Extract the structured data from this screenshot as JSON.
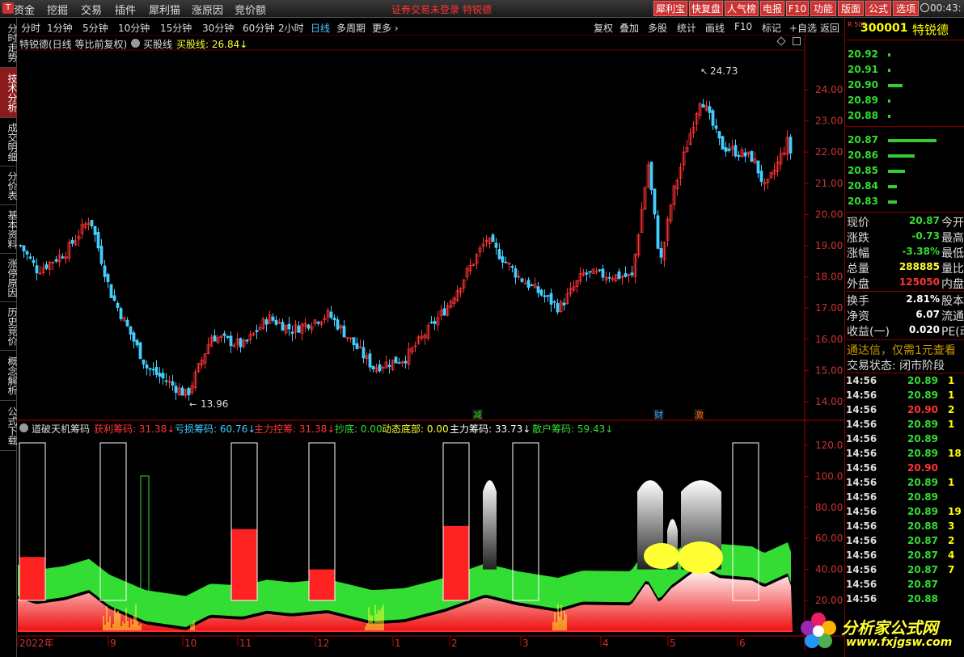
{
  "menu": {
    "items": [
      "资金",
      "挖掘",
      "交易",
      "插件",
      "犀利猫",
      "涨原因",
      "竞价额"
    ],
    "notice": "证券交易未登录  特锐德",
    "right_buttons": [
      "犀利宝",
      "快复盘",
      "人气榜",
      "电报",
      "F10",
      "功能",
      "版面",
      "公式",
      "选项"
    ],
    "clock": "00:43:"
  },
  "left_tabs": [
    "分时走势",
    "技术分析",
    "成交明细",
    "分价表",
    "基本资料",
    "涨停原因",
    "历史竞价",
    "概念解析",
    "公式下载"
  ],
  "periods": [
    "分时",
    "1分钟",
    "5分钟",
    "10分钟",
    "15分钟",
    "30分钟",
    "60分钟",
    "2小时",
    "日线",
    "多周期",
    "更多 ›"
  ],
  "toolbar_right": [
    "复权",
    "叠加",
    "多股",
    "统计",
    "画线",
    "F10",
    "标记",
    "+自选",
    "返回"
  ],
  "main_header": {
    "title": "特锐德(日线 等比前复权)",
    "indicator": "买股线",
    "buy_line": "买股线: 26.84↓"
  },
  "sub_header": {
    "name": "道破天机筹码",
    "items": [
      {
        "text": "获利筹码: 31.38↓",
        "color": "#ff3333"
      },
      {
        "text": "亏损筹码: 60.76↓",
        "color": "#44ccff"
      },
      {
        "text": "主力控筹: 31.38↓",
        "color": "#ff3333"
      },
      {
        "text": "抄底: 0.00",
        "color": "#33dd33"
      },
      {
        "text": "动态底部: 0.00",
        "color": "#ffff33"
      },
      {
        "text": "主力筹码: 33.73↓",
        "color": "#ffffff"
      },
      {
        "text": "散户筹码: 59.43↓",
        "color": "#33dd33"
      }
    ]
  },
  "main_axis": [
    "24.00",
    "23.00",
    "22.00",
    "21.00",
    "20.00",
    "19.00",
    "18.00",
    "17.00",
    "16.00",
    "15.00",
    "14.00"
  ],
  "sub_axis": [
    "120.0",
    "100.0",
    "80.00",
    "60.00",
    "40.00",
    "20.00"
  ],
  "high_label": "24.73",
  "low_label": "13.96",
  "markers": [
    {
      "text": "减",
      "color": "#33dd33"
    },
    {
      "text": "财",
      "color": "#44aaff"
    },
    {
      "text": "激",
      "color": "#ff6600"
    }
  ],
  "time_axis": [
    "2022年",
    "9",
    "10",
    "11",
    "12",
    "1",
    "2",
    "3",
    "4",
    "5",
    "6"
  ],
  "quote": {
    "code": "300001",
    "name": "特锐德",
    "r_label": "R 500",
    "asks": [
      {
        "price": "20.92",
        "vol": 0.05
      },
      {
        "price": "20.91",
        "vol": 0.05
      },
      {
        "price": "20.90",
        "vol": 0.3
      },
      {
        "price": "20.89",
        "vol": 0.05
      },
      {
        "price": "20.88",
        "vol": 0.05
      }
    ],
    "bids": [
      {
        "price": "20.87",
        "vol": 1.0
      },
      {
        "price": "20.86",
        "vol": 0.55
      },
      {
        "price": "20.85",
        "vol": 0.35
      },
      {
        "price": "20.84",
        "vol": 0.18
      },
      {
        "price": "20.83",
        "vol": 0.18
      }
    ],
    "stats": [
      {
        "label": "现价",
        "value": "20.87",
        "color": "#33dd33",
        "right": "今开"
      },
      {
        "label": "涨跌",
        "value": "-0.73",
        "color": "#33dd33",
        "right": "最高"
      },
      {
        "label": "涨幅",
        "value": "-3.38%",
        "color": "#33dd33",
        "right": "最低"
      },
      {
        "label": "总量",
        "value": "288885",
        "color": "#ffff33",
        "right": "量比"
      },
      {
        "label": "外盘",
        "value": "125050",
        "color": "#ff3333",
        "right": "内盘"
      },
      {
        "label": "换手",
        "value": "2.81%",
        "color": "#ffffff",
        "right": "股本"
      },
      {
        "label": "净资",
        "value": "6.07",
        "color": "#ffffff",
        "right": "流通"
      },
      {
        "label": "收益(一)",
        "value": "0.020",
        "color": "#ffffff",
        "right": "PE(动"
      }
    ],
    "ad": "通达信，仅需1元查看",
    "trade_status": "交易状态: 闭市阶段",
    "ticks": [
      {
        "t": "14:56",
        "p": "20.89",
        "v": "1"
      },
      {
        "t": "14:56",
        "p": "20.89",
        "v": "1"
      },
      {
        "t": "14:56",
        "p": "20.90",
        "v": "2"
      },
      {
        "t": "14:56",
        "p": "20.89",
        "v": "1"
      },
      {
        "t": "14:56",
        "p": "20.89",
        "v": ""
      },
      {
        "t": "14:56",
        "p": "20.89",
        "v": "18"
      },
      {
        "t": "14:56",
        "p": "20.90",
        "v": ""
      },
      {
        "t": "14:56",
        "p": "20.89",
        "v": "1"
      },
      {
        "t": "14:56",
        "p": "20.89",
        "v": ""
      },
      {
        "t": "14:56",
        "p": "20.89",
        "v": "19"
      },
      {
        "t": "14:56",
        "p": "20.88",
        "v": "3"
      },
      {
        "t": "14:56",
        "p": "20.87",
        "v": "2"
      },
      {
        "t": "14:56",
        "p": "20.87",
        "v": "4"
      },
      {
        "t": "14:56",
        "p": "20.87",
        "v": "7"
      },
      {
        "t": "14:56",
        "p": "20.87",
        "v": ""
      },
      {
        "t": "14:56",
        "p": "20.88",
        "v": ""
      }
    ]
  },
  "watermark": {
    "name": "分析家公式网",
    "url": "www.fxjgsw.com"
  },
  "colors": {
    "up": "#ff3333",
    "down": "#44ccff",
    "green": "#33dd33",
    "yellow": "#ffff33",
    "magenta": "#ff33ff"
  }
}
